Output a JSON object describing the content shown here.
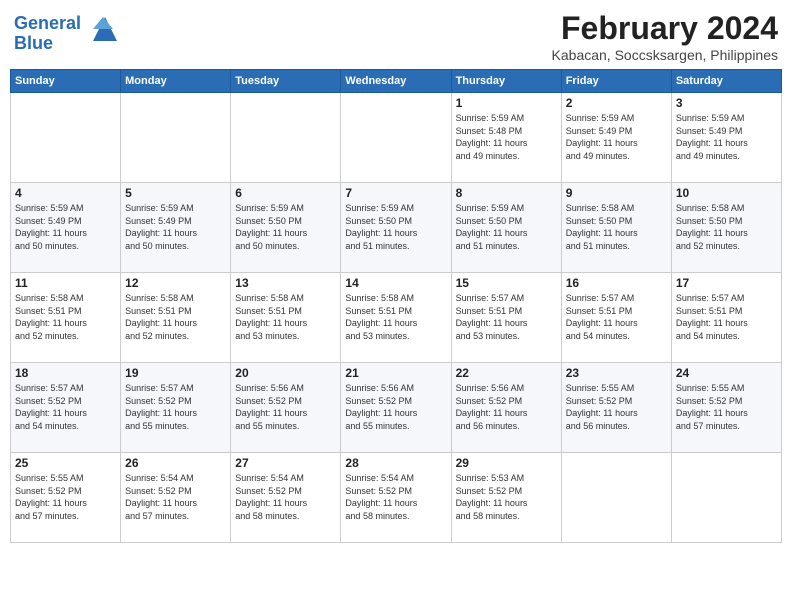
{
  "logo": {
    "line1": "General",
    "line2": "Blue"
  },
  "title": "February 2024",
  "location": "Kabacan, Soccsksargen, Philippines",
  "weekdays": [
    "Sunday",
    "Monday",
    "Tuesday",
    "Wednesday",
    "Thursday",
    "Friday",
    "Saturday"
  ],
  "weeks": [
    [
      {
        "day": "",
        "info": ""
      },
      {
        "day": "",
        "info": ""
      },
      {
        "day": "",
        "info": ""
      },
      {
        "day": "",
        "info": ""
      },
      {
        "day": "1",
        "info": "Sunrise: 5:59 AM\nSunset: 5:48 PM\nDaylight: 11 hours\nand 49 minutes."
      },
      {
        "day": "2",
        "info": "Sunrise: 5:59 AM\nSunset: 5:49 PM\nDaylight: 11 hours\nand 49 minutes."
      },
      {
        "day": "3",
        "info": "Sunrise: 5:59 AM\nSunset: 5:49 PM\nDaylight: 11 hours\nand 49 minutes."
      }
    ],
    [
      {
        "day": "4",
        "info": "Sunrise: 5:59 AM\nSunset: 5:49 PM\nDaylight: 11 hours\nand 50 minutes."
      },
      {
        "day": "5",
        "info": "Sunrise: 5:59 AM\nSunset: 5:49 PM\nDaylight: 11 hours\nand 50 minutes."
      },
      {
        "day": "6",
        "info": "Sunrise: 5:59 AM\nSunset: 5:50 PM\nDaylight: 11 hours\nand 50 minutes."
      },
      {
        "day": "7",
        "info": "Sunrise: 5:59 AM\nSunset: 5:50 PM\nDaylight: 11 hours\nand 51 minutes."
      },
      {
        "day": "8",
        "info": "Sunrise: 5:59 AM\nSunset: 5:50 PM\nDaylight: 11 hours\nand 51 minutes."
      },
      {
        "day": "9",
        "info": "Sunrise: 5:58 AM\nSunset: 5:50 PM\nDaylight: 11 hours\nand 51 minutes."
      },
      {
        "day": "10",
        "info": "Sunrise: 5:58 AM\nSunset: 5:50 PM\nDaylight: 11 hours\nand 52 minutes."
      }
    ],
    [
      {
        "day": "11",
        "info": "Sunrise: 5:58 AM\nSunset: 5:51 PM\nDaylight: 11 hours\nand 52 minutes."
      },
      {
        "day": "12",
        "info": "Sunrise: 5:58 AM\nSunset: 5:51 PM\nDaylight: 11 hours\nand 52 minutes."
      },
      {
        "day": "13",
        "info": "Sunrise: 5:58 AM\nSunset: 5:51 PM\nDaylight: 11 hours\nand 53 minutes."
      },
      {
        "day": "14",
        "info": "Sunrise: 5:58 AM\nSunset: 5:51 PM\nDaylight: 11 hours\nand 53 minutes."
      },
      {
        "day": "15",
        "info": "Sunrise: 5:57 AM\nSunset: 5:51 PM\nDaylight: 11 hours\nand 53 minutes."
      },
      {
        "day": "16",
        "info": "Sunrise: 5:57 AM\nSunset: 5:51 PM\nDaylight: 11 hours\nand 54 minutes."
      },
      {
        "day": "17",
        "info": "Sunrise: 5:57 AM\nSunset: 5:51 PM\nDaylight: 11 hours\nand 54 minutes."
      }
    ],
    [
      {
        "day": "18",
        "info": "Sunrise: 5:57 AM\nSunset: 5:52 PM\nDaylight: 11 hours\nand 54 minutes."
      },
      {
        "day": "19",
        "info": "Sunrise: 5:57 AM\nSunset: 5:52 PM\nDaylight: 11 hours\nand 55 minutes."
      },
      {
        "day": "20",
        "info": "Sunrise: 5:56 AM\nSunset: 5:52 PM\nDaylight: 11 hours\nand 55 minutes."
      },
      {
        "day": "21",
        "info": "Sunrise: 5:56 AM\nSunset: 5:52 PM\nDaylight: 11 hours\nand 55 minutes."
      },
      {
        "day": "22",
        "info": "Sunrise: 5:56 AM\nSunset: 5:52 PM\nDaylight: 11 hours\nand 56 minutes."
      },
      {
        "day": "23",
        "info": "Sunrise: 5:55 AM\nSunset: 5:52 PM\nDaylight: 11 hours\nand 56 minutes."
      },
      {
        "day": "24",
        "info": "Sunrise: 5:55 AM\nSunset: 5:52 PM\nDaylight: 11 hours\nand 57 minutes."
      }
    ],
    [
      {
        "day": "25",
        "info": "Sunrise: 5:55 AM\nSunset: 5:52 PM\nDaylight: 11 hours\nand 57 minutes."
      },
      {
        "day": "26",
        "info": "Sunrise: 5:54 AM\nSunset: 5:52 PM\nDaylight: 11 hours\nand 57 minutes."
      },
      {
        "day": "27",
        "info": "Sunrise: 5:54 AM\nSunset: 5:52 PM\nDaylight: 11 hours\nand 58 minutes."
      },
      {
        "day": "28",
        "info": "Sunrise: 5:54 AM\nSunset: 5:52 PM\nDaylight: 11 hours\nand 58 minutes."
      },
      {
        "day": "29",
        "info": "Sunrise: 5:53 AM\nSunset: 5:52 PM\nDaylight: 11 hours\nand 58 minutes."
      },
      {
        "day": "",
        "info": ""
      },
      {
        "day": "",
        "info": ""
      }
    ]
  ]
}
